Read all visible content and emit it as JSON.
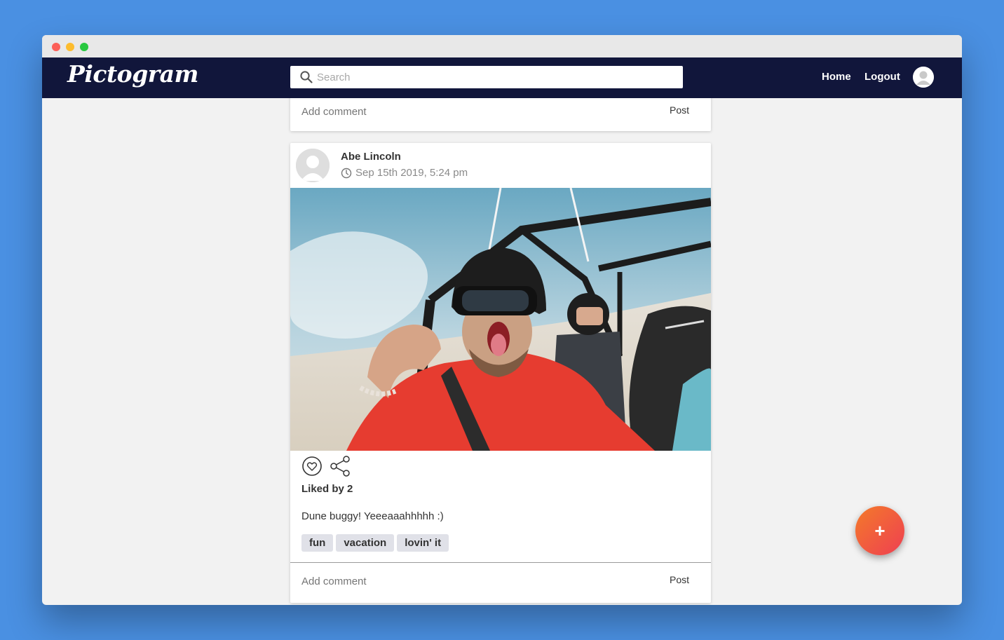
{
  "app": {
    "logo_text": "Pictogram"
  },
  "nav": {
    "search_placeholder": "Search",
    "home_label": "Home",
    "logout_label": "Logout"
  },
  "previous_post": {
    "comment_placeholder": "Add comment",
    "post_label": "Post"
  },
  "post": {
    "author": "Abe Lincoln",
    "timestamp": "Sep 15th 2019, 5:24 pm",
    "liked_by": "Liked by 2",
    "caption": "Dune buggy! Yeeeaaahhhhh :)",
    "tags": [
      "fun",
      "vacation",
      "lovin' it"
    ],
    "comment_placeholder": "Add comment",
    "post_label": "Post"
  },
  "fab": {
    "label": "+"
  },
  "colors": {
    "page_background": "#4a90e2",
    "navbar": "#11163b",
    "fab_gradient_start": "#f47a2a",
    "fab_gradient_end": "#ee3f52",
    "tag_background": "#e0e1e8"
  }
}
